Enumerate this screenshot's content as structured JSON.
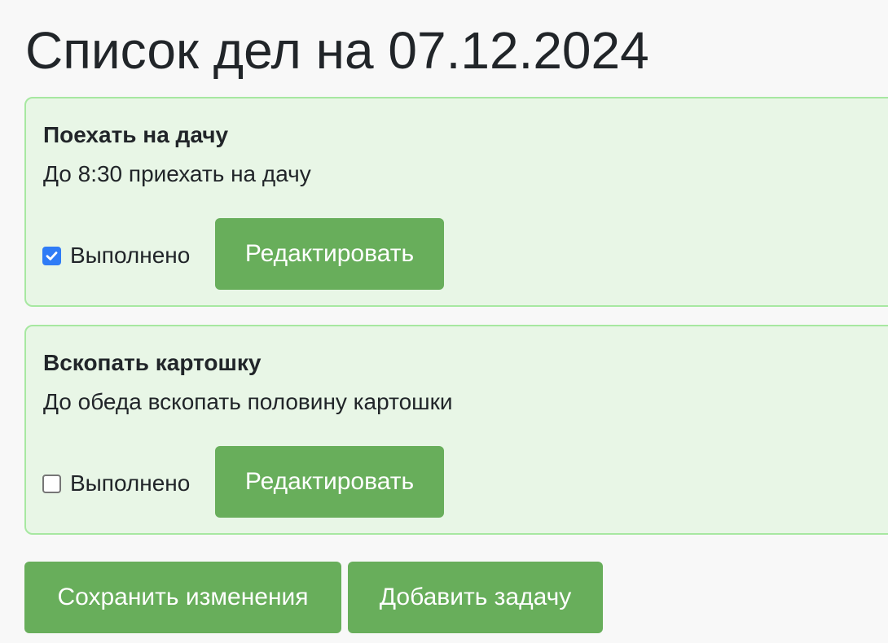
{
  "page": {
    "title": "Список дел на 07.12.2024"
  },
  "tasks": [
    {
      "title": "Поехать на дачу",
      "description": "До 8:30 приехать на дачу",
      "done_label": "Выполнено",
      "done": true,
      "edit_label": "Редактировать"
    },
    {
      "title": "Вскопать картошку",
      "description": "До обеда вскопать половину картошки",
      "done_label": "Выполнено",
      "done": false,
      "edit_label": "Редактировать"
    }
  ],
  "actions": {
    "save_label": "Сохранить изменения",
    "add_label": "Добавить задачу"
  },
  "colors": {
    "card_background": "#e8f6e6",
    "card_border": "#a7e8a1",
    "button": "#68ae5b",
    "checkbox_checked": "#2f7cf6"
  },
  "icons": {
    "checked": "checkbox-checked-icon",
    "unchecked": "checkbox-unchecked-icon"
  }
}
